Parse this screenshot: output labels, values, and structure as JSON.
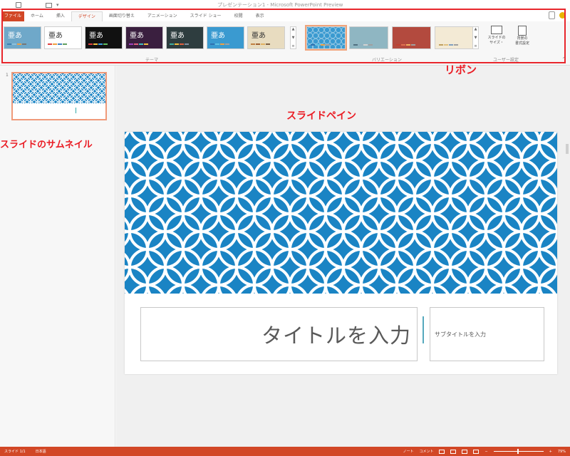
{
  "app": {
    "title": "プレゼンテーション1 - Microsoft PowerPoint Preview"
  },
  "tabs": [
    {
      "label": "ファイル",
      "active": false,
      "kind": "file"
    },
    {
      "label": "ホーム",
      "active": false
    },
    {
      "label": "挿入",
      "active": false
    },
    {
      "label": "デザイン",
      "active": true
    },
    {
      "label": "画面切り替え",
      "active": false
    },
    {
      "label": "アニメーション",
      "active": false
    },
    {
      "label": "スライド ショー",
      "active": false
    },
    {
      "label": "校閲",
      "active": false
    },
    {
      "label": "表示",
      "active": false
    }
  ],
  "ribbon": {
    "themes_label": "テーマ",
    "variants_label": "バリエーション",
    "user_settings_label": "ユーザー設定",
    "slide_size_label": "スライドの\nサイズ・",
    "format_bg_label": "背景の\n書式設定",
    "theme_sample": "亜あ",
    "themes": [
      {
        "bg": "#6fa8c9",
        "fg": "#ffffff",
        "bars": [
          "#3d7fb0",
          "#8cc1dc",
          "#f0a040",
          "#777777"
        ]
      },
      {
        "bg": "#ffffff",
        "fg": "#333333",
        "bars": [
          "#e04040",
          "#f0a040",
          "#4080c0",
          "#60a060"
        ]
      },
      {
        "bg": "#111111",
        "fg": "#ffffff",
        "bars": [
          "#e04040",
          "#f0c040",
          "#40a0e0",
          "#60c060"
        ]
      },
      {
        "bg": "#3a1f3f",
        "fg": "#ffffff",
        "bars": [
          "#a040c0",
          "#e06080",
          "#40c0c0",
          "#f0c040"
        ]
      },
      {
        "bg": "#2e3d3f",
        "fg": "#ffffff",
        "bars": [
          "#40b0a0",
          "#f0c040",
          "#e06040",
          "#8090a0"
        ]
      },
      {
        "bg": "#3a9ad0",
        "fg": "#ffffff",
        "bars": [
          "#3070b0",
          "#60c0e0",
          "#f0a040",
          "#a0a0a0"
        ]
      },
      {
        "bg": "#e8dcc0",
        "fg": "#333333",
        "bars": [
          "#c08040",
          "#a06030",
          "#e0b060",
          "#806040"
        ]
      }
    ],
    "variants": [
      {
        "bg": "#3a9ad0",
        "bars": [
          "#3070b0",
          "#60c0e0",
          "#f0a040",
          "#a0a0a0"
        ],
        "selected": true
      },
      {
        "bg": "#8fb6c2",
        "bars": [
          "#507080",
          "#90b0c0",
          "#d0d0d0",
          "#a0a0a0"
        ],
        "selected": false
      },
      {
        "bg": "#b34a3e",
        "bars": [
          "#c04030",
          "#e07050",
          "#f0b060",
          "#a0a0a0"
        ],
        "selected": false
      },
      {
        "bg": "#f3ead5",
        "bars": [
          "#c0a060",
          "#e0c080",
          "#80a0c0",
          "#a0a0a0"
        ],
        "selected": false
      }
    ]
  },
  "thumbnails": {
    "number": "1"
  },
  "slide": {
    "pattern_color": "#1a84c4",
    "title_placeholder": "タイトルを入力",
    "subtitle_placeholder": "サブタイトルを入力"
  },
  "annotations": {
    "ribbon": "リボン",
    "slide_pane": "スライドペイン",
    "thumbnail": "スライドのサムネイル"
  },
  "status": {
    "slide": "スライド 1/1",
    "language": "日本語",
    "notes": "ノート",
    "comments": "コメント",
    "zoom": "79%"
  }
}
